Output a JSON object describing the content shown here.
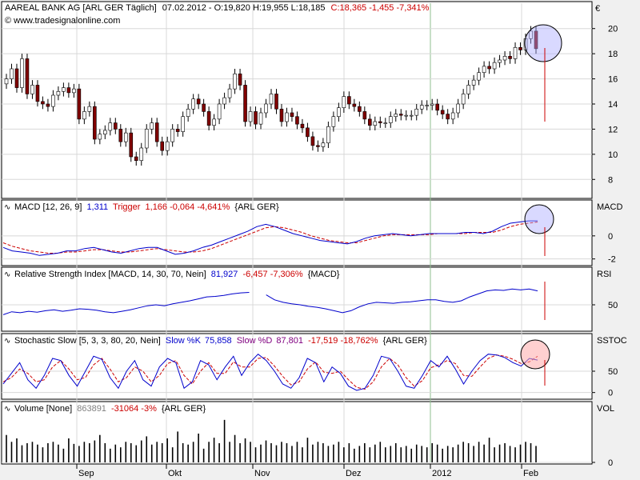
{
  "header": {
    "symbol_text": "AAREAL BANK AG [ARL GER  Täglich]",
    "date_open": "07.02.2012 - O:19,820 H:19,955 L:18,185",
    "close_change": "C:18,365 -1,455 -7,341%",
    "source": "© www.tradesignalonline.com",
    "currency": "€"
  },
  "x_axis": {
    "months": [
      "Sep",
      "Okt",
      "Nov",
      "Dez",
      "2012",
      "Feb"
    ]
  },
  "colors": {
    "up": "#ffffff",
    "down": "#800000",
    "line_blue": "#0000cc",
    "line_red_dash": "#cc0000",
    "change_red": "#cc0000",
    "value_blue": "#0000cc",
    "circle_fill": "rgba(170,170,255,0.45)",
    "circle_fill_pink": "rgba(255,170,170,0.55)"
  },
  "chart_data": [
    {
      "type": "candlestick",
      "name": "price",
      "y_unit": "€",
      "ylim": [
        7,
        21
      ],
      "yticks": [
        8,
        10,
        12,
        14,
        16,
        18,
        20
      ],
      "close_values": [
        16.0,
        16.8,
        15.3,
        17.6,
        14.8,
        15.5,
        14.2,
        14.0,
        13.8,
        14.7,
        15.0,
        15.3,
        14.9,
        15.2,
        12.8,
        13.4,
        13.8,
        11.2,
        11.6,
        11.9,
        12.5,
        12.0,
        11.0,
        11.7,
        9.8,
        9.5,
        10.5,
        12.0,
        12.5,
        11.0,
        10.3,
        11.0,
        12.0,
        11.8,
        13.0,
        13.6,
        14.4,
        14.0,
        13.4,
        12.3,
        12.8,
        14.0,
        14.5,
        15.2,
        16.4,
        15.5,
        12.6,
        13.4,
        12.4,
        13.3,
        14.0,
        14.8,
        13.6,
        12.6,
        13.3,
        13.0,
        12.4,
        12.1,
        11.4,
        10.7,
        10.6,
        10.9,
        12.2,
        13.0,
        13.7,
        14.6,
        14.0,
        13.8,
        13.4,
        12.8,
        12.3,
        12.6,
        12.5,
        12.5,
        13.0,
        13.2,
        13.1,
        13.1,
        13.1,
        13.6,
        13.9,
        13.9,
        14.0,
        13.5,
        13.2,
        12.8,
        13.3,
        14.0,
        14.8,
        15.5,
        15.9,
        16.5,
        17.0,
        16.8,
        17.3,
        17.5,
        17.8,
        17.6,
        18.5,
        18.3,
        19.2,
        19.8,
        18.4
      ]
    },
    {
      "type": "line",
      "name": "MACD",
      "label": "MACD [12, 26, 9]",
      "value": "1,311",
      "trigger_label": "Trigger",
      "trigger_value": "1,166 -0,064 -4,641%",
      "symbol": "{ARL GER}",
      "ylim": [
        -2.3,
        2.0
      ],
      "yticks": [
        -2,
        0
      ],
      "series": [
        {
          "name": "MACD",
          "values": [
            -1.0,
            -1.3,
            -1.4,
            -1.5,
            -1.7,
            -1.6,
            -1.5,
            -1.3,
            -1.3,
            -1.1,
            -1.0,
            -1.2,
            -1.4,
            -1.5,
            -1.3,
            -1.1,
            -1.0,
            -1.0,
            -1.3,
            -1.6,
            -1.5,
            -1.3,
            -1.0,
            -0.8,
            -0.5,
            -0.2,
            0.1,
            0.4,
            0.8,
            1.0,
            0.8,
            0.5,
            0.2,
            0.0,
            -0.2,
            -0.4,
            -0.5,
            -0.6,
            -0.7,
            -0.5,
            -0.2,
            0.0,
            0.1,
            0.2,
            0.1,
            0.0,
            0.1,
            0.2,
            0.2,
            0.2,
            0.2,
            0.3,
            0.3,
            0.2,
            0.4,
            0.8,
            1.1,
            1.2,
            1.3,
            1.3
          ]
        },
        {
          "name": "Trigger",
          "values": [
            -0.6,
            -0.9,
            -1.1,
            -1.3,
            -1.4,
            -1.5,
            -1.5,
            -1.4,
            -1.4,
            -1.3,
            -1.2,
            -1.2,
            -1.3,
            -1.4,
            -1.4,
            -1.3,
            -1.2,
            -1.1,
            -1.2,
            -1.3,
            -1.4,
            -1.4,
            -1.3,
            -1.1,
            -0.8,
            -0.5,
            -0.2,
            0.1,
            0.4,
            0.7,
            0.8,
            0.7,
            0.5,
            0.3,
            0.0,
            -0.2,
            -0.4,
            -0.5,
            -0.6,
            -0.6,
            -0.4,
            -0.2,
            0.0,
            0.1,
            0.1,
            0.1,
            0.1,
            0.1,
            0.2,
            0.2,
            0.2,
            0.2,
            0.3,
            0.3,
            0.3,
            0.5,
            0.8,
            1.0,
            1.1,
            1.2
          ]
        }
      ]
    },
    {
      "type": "line",
      "name": "RSI",
      "label": "Relative Strength Index [MACD, 14, 30, 70, Nein]",
      "value": "81,927",
      "change": "-6,457 -7,306%",
      "symbol": "{MACD}",
      "ylim": [
        0,
        100
      ],
      "yticks": [
        50
      ],
      "series": [
        {
          "name": "RSI",
          "values": [
            30,
            36,
            34,
            37,
            35,
            38,
            40,
            37,
            39,
            42,
            41,
            39,
            36,
            34,
            37,
            40,
            44,
            48,
            50,
            48,
            52,
            55,
            58,
            62,
            66,
            67,
            69,
            72,
            74,
            75,
            null,
            70,
            60,
            55,
            52,
            50,
            47,
            45,
            42,
            38,
            34,
            38,
            46,
            52,
            55,
            54,
            53,
            55,
            56,
            58,
            60,
            60,
            57,
            55,
            58,
            66,
            72,
            78,
            80,
            79,
            82,
            80,
            82,
            78
          ]
        }
      ]
    },
    {
      "type": "line",
      "name": "Stochastic Slow",
      "label": "Stochastic Slow [5, 3, 3, 80, 20, Nein]",
      "k_label": "Slow %K",
      "k_value": "75,858",
      "d_label": "Slow %D",
      "d_value": "87,801",
      "change": "-17,519 -18,762%",
      "symbol": "{ARL GER}",
      "ylim": [
        -10,
        110
      ],
      "yticks": [
        0,
        50
      ],
      "series": [
        {
          "name": "Slow %K",
          "values": [
            20,
            45,
            70,
            30,
            10,
            40,
            80,
            75,
            40,
            15,
            50,
            85,
            78,
            35,
            10,
            50,
            75,
            30,
            15,
            60,
            80,
            70,
            10,
            25,
            75,
            65,
            30,
            60,
            85,
            40,
            70,
            90,
            75,
            50,
            20,
            10,
            35,
            80,
            70,
            25,
            60,
            45,
            15,
            5,
            10,
            40,
            85,
            80,
            50,
            15,
            10,
            40,
            75,
            60,
            85,
            55,
            20,
            50,
            75,
            90,
            88,
            82,
            70,
            62,
            80,
            76
          ]
        },
        {
          "name": "Slow %D",
          "values": [
            25,
            35,
            55,
            45,
            25,
            30,
            60,
            75,
            55,
            30,
            35,
            65,
            80,
            55,
            25,
            35,
            60,
            50,
            25,
            40,
            68,
            75,
            40,
            20,
            50,
            70,
            45,
            45,
            72,
            60,
            60,
            80,
            82,
            62,
            38,
            18,
            25,
            55,
            72,
            48,
            45,
            50,
            30,
            12,
            8,
            25,
            60,
            80,
            65,
            35,
            15,
            28,
            58,
            65,
            75,
            68,
            40,
            38,
            60,
            80,
            88,
            85,
            78,
            68,
            72,
            85
          ]
        }
      ]
    },
    {
      "type": "bar",
      "name": "Volume",
      "label": "Volume [None]",
      "value": "863891",
      "change": "-31064 -3%",
      "symbol": "{ARL GER}",
      "yticks": [
        0
      ],
      "values": [
        40,
        30,
        35,
        25,
        28,
        30,
        26,
        22,
        28,
        30,
        26,
        20,
        35,
        27,
        24,
        30,
        28,
        32,
        40,
        28,
        20,
        26,
        22,
        30,
        28,
        25,
        32,
        38,
        26,
        30,
        28,
        35,
        22,
        45,
        28,
        26,
        30,
        42,
        20,
        30,
        36,
        28,
        62,
        30,
        40,
        28,
        35,
        30,
        22,
        26,
        32,
        28,
        25,
        30,
        28,
        24,
        30,
        22,
        36,
        26,
        30,
        28,
        24,
        26,
        30,
        22,
        28,
        20,
        24,
        28,
        22,
        26,
        30,
        22,
        24,
        28,
        22,
        24,
        20,
        26,
        24,
        22,
        28,
        26,
        20,
        24,
        22,
        26,
        30,
        28,
        24,
        30,
        26,
        36,
        22,
        26,
        28,
        24,
        22,
        26,
        30,
        28,
        24
      ]
    }
  ]
}
